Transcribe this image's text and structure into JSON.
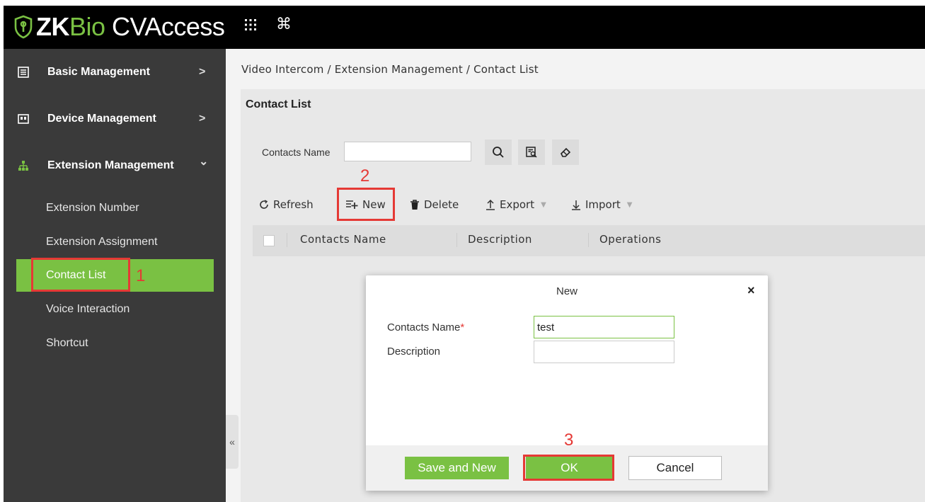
{
  "app": {
    "logo_zk": "ZK",
    "logo_bio": "Bio",
    "logo_cv": " CVAccess",
    "apps_icon": "grid-icon",
    "shortcut_icon": "command-icon"
  },
  "sidebar": {
    "menus": [
      {
        "label": "Basic Management",
        "icon": "list-icon",
        "arrow": ">"
      },
      {
        "label": "Device Management",
        "icon": "device-icon",
        "arrow": ">"
      },
      {
        "label": "Extension Management",
        "icon": "org-tree-icon",
        "arrow": "⌄"
      }
    ],
    "items": [
      {
        "label": "Extension Number"
      },
      {
        "label": "Extension Assignment"
      },
      {
        "label": "Contact List",
        "active": true
      },
      {
        "label": "Voice Interaction"
      },
      {
        "label": "Shortcut"
      }
    ],
    "collapse": "«"
  },
  "breadcrumb": "Video Intercom / Extension Management / Contact List",
  "page_title": "Contact List",
  "search": {
    "label": "Contacts Name",
    "value": ""
  },
  "toolbar": {
    "refresh": "Refresh",
    "new": "New",
    "delete": "Delete",
    "export": "Export",
    "import": "Import"
  },
  "table": {
    "columns": [
      "Contacts Name",
      "Description",
      "Operations"
    ]
  },
  "callouts": [
    "1",
    "2",
    "3"
  ],
  "dialog": {
    "title": "New",
    "close": "×",
    "name_label": "Contacts Name",
    "required_mark": "*",
    "name_value": "test",
    "desc_label": "Description",
    "desc_value": "",
    "save_new": "Save and New",
    "ok": "OK",
    "cancel": "Cancel"
  },
  "colors": {
    "accent": "#7ac143",
    "callout": "#e53935",
    "sidebar_bg": "#3a3a3a"
  }
}
